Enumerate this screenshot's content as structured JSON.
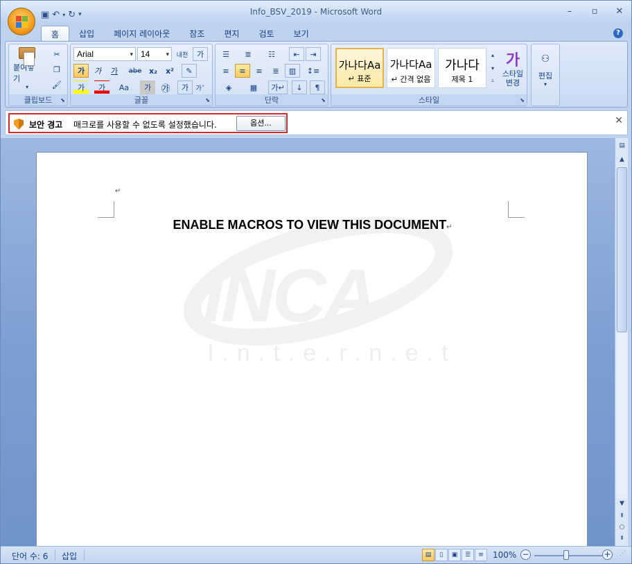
{
  "app": {
    "window_title": "Info_BSV_2019",
    "app_name": "Microsoft Word",
    "title_separator": " - "
  },
  "tabs": [
    "홈",
    "삽입",
    "페이지 레이아웃",
    "참조",
    "편지",
    "검토",
    "보기"
  ],
  "ribbon": {
    "clipboard": {
      "paste_label": "붙여넣기",
      "group_label": "클립보드"
    },
    "font": {
      "font_name": "Arial",
      "font_size": "14",
      "group_label": "글꼴",
      "grow_label": "가",
      "bold": "가",
      "italic": "가",
      "underline": "가",
      "strike": "abe",
      "subscript": "x₂",
      "superscript": "x²",
      "change_case": "Aa",
      "highlight": "가",
      "font_color": "가",
      "char_shading": "가",
      "enclose": "㉮",
      "phonetic": "내천",
      "char_border": "가"
    },
    "paragraph": {
      "group_label": "단락"
    },
    "styles": {
      "group_label": "스타일",
      "items": [
        {
          "sample": "가나다Aa",
          "name": "↵ 표준"
        },
        {
          "sample": "가나다Aa",
          "name": "↵ 간격 없음"
        },
        {
          "sample": "가나다",
          "name": "제목 1"
        }
      ],
      "change_styles_label": "스타일\n변경"
    },
    "editing": {
      "label": "편집"
    }
  },
  "message_bar": {
    "title": "보안 경고",
    "text": "매크로를 사용할 수 없도록 설정했습니다.",
    "options_button": "옵션..."
  },
  "document": {
    "heading": "ENABLE MACROS TO VIEW THIS DOCUMENT",
    "para_mark": "↵",
    "watermark_logo": "INCA",
    "watermark_sub": "I.n.t.e.r.n.e.t"
  },
  "status_bar": {
    "word_count": "단어 수: 6",
    "mode": "삽입",
    "zoom": "100%",
    "zoom_level_percent": 100
  },
  "colors": {
    "title_bar": "#c9dbf3",
    "ribbon": "#dfeafa",
    "doc_background": "#7e9fd3",
    "alert_outline": "#d42a2a",
    "highlight": "#ffc95a"
  }
}
